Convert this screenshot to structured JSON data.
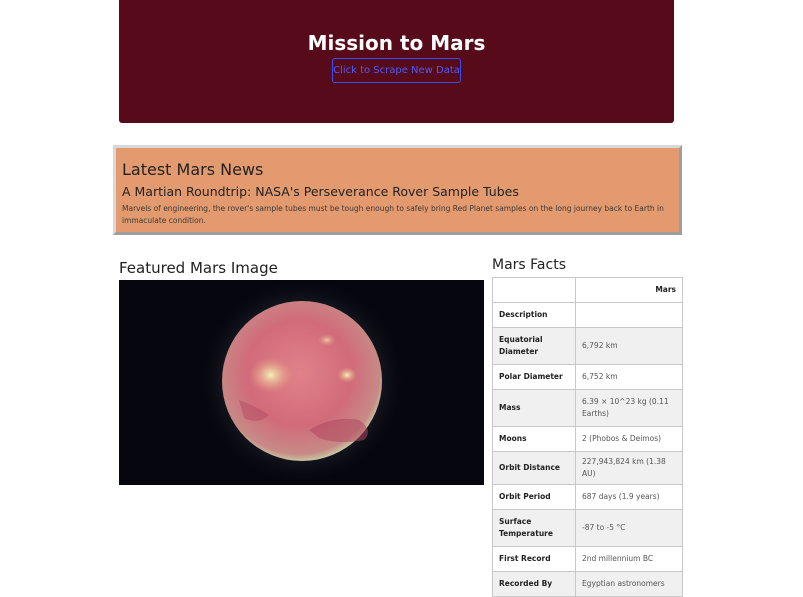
{
  "header": {
    "title": "Mission to Mars",
    "scrape_button_label": "Click to Scrape New Data"
  },
  "news": {
    "section_title": "Latest Mars News",
    "headline": "A Martian Roundtrip: NASA's Perseverance Rover Sample Tubes",
    "teaser": "Marvels of engineering, the rover's sample tubes must be tough enough to safely bring Red Planet samples on the long journey back to Earth in immaculate condition."
  },
  "featured": {
    "section_title": "Featured Mars Image"
  },
  "facts": {
    "section_title": "Mars Facts",
    "column_header": "Mars",
    "rows": [
      {
        "label": "Description",
        "value": ""
      },
      {
        "label": "Equatorial Diameter",
        "value": "6,792 km"
      },
      {
        "label": "Polar Diameter",
        "value": "6,752 km"
      },
      {
        "label": "Mass",
        "value": "6.39 × 10^23 kg (0.11 Earths)"
      },
      {
        "label": "Moons",
        "value": "2 (Phobos & Deimos)"
      },
      {
        "label": "Orbit Distance",
        "value": "227,943,824 km (1.38 AU)"
      },
      {
        "label": "Orbit Period",
        "value": "687 days (1.9 years)"
      },
      {
        "label": "Surface Temperature",
        "value": "-87 to -5 °C"
      },
      {
        "label": "First Record",
        "value": "2nd millennium BC"
      },
      {
        "label": "Recorded By",
        "value": "Egyptian astronomers"
      }
    ]
  },
  "colors": {
    "header_bg": "#560a1a",
    "news_bg": "#e39a6e",
    "button_border": "#3b4ef0"
  }
}
